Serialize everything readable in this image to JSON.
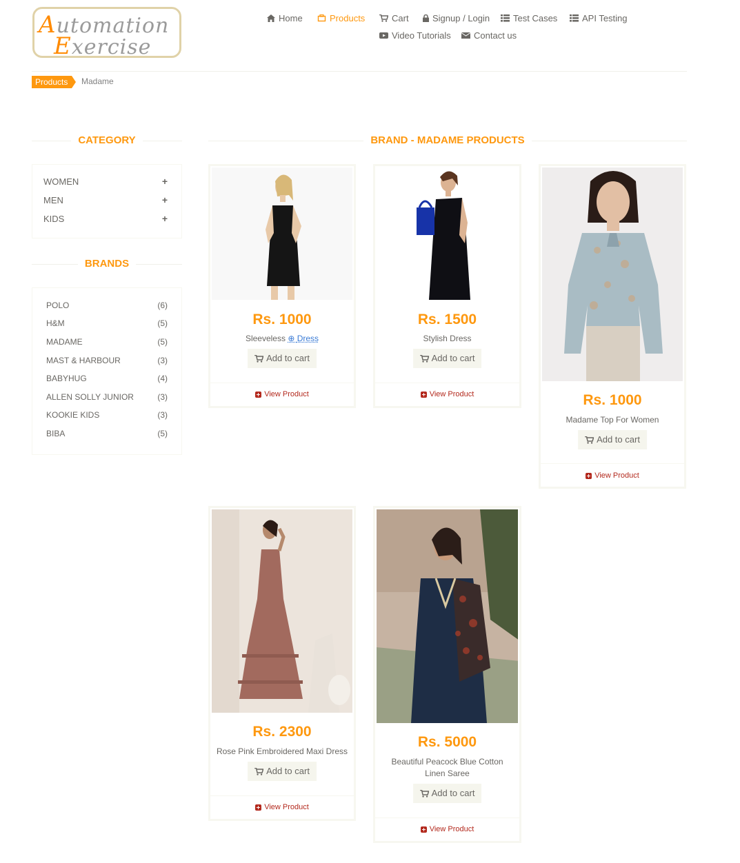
{
  "header": {
    "logo_line1": "Automation",
    "logo_line2": "Exercise",
    "nav": [
      {
        "label": "Home",
        "icon": "home-icon"
      },
      {
        "label": "Products",
        "icon": "tshirt-icon",
        "active": true
      },
      {
        "label": "Cart",
        "icon": "cart-icon"
      },
      {
        "label": "Signup / Login",
        "icon": "lock-icon"
      },
      {
        "label": "Test Cases",
        "icon": "list-icon"
      },
      {
        "label": "API Testing",
        "icon": "list-icon"
      },
      {
        "label": "Video Tutorials",
        "icon": "youtube-icon"
      },
      {
        "label": "Contact us",
        "icon": "envelope-icon"
      }
    ]
  },
  "breadcrumb": {
    "parent": "Products",
    "current": "Madame"
  },
  "sidebar": {
    "category_title": "Category",
    "categories": [
      {
        "label": "Women",
        "toggle": "+"
      },
      {
        "label": "Men",
        "toggle": "+"
      },
      {
        "label": "Kids",
        "toggle": "+"
      }
    ],
    "brands_title": "Brands",
    "brands": [
      {
        "name": "Polo",
        "count": "(6)"
      },
      {
        "name": "H&M",
        "count": "(5)"
      },
      {
        "name": "Madame",
        "count": "(5)"
      },
      {
        "name": "Mast & Harbour",
        "count": "(3)"
      },
      {
        "name": "Babyhug",
        "count": "(4)"
      },
      {
        "name": "Allen Solly Junior",
        "count": "(3)"
      },
      {
        "name": "Kookie Kids",
        "count": "(3)"
      },
      {
        "name": "Biba",
        "count": "(5)"
      }
    ]
  },
  "main": {
    "title": "Brand - Madame Products",
    "add_to_cart_label": "Add to cart",
    "view_product_label": "View Product",
    "products": [
      {
        "price": "Rs. 1000",
        "name_part1": "Sleeveless",
        "name_part2": "Dress",
        "name": "Sleeveless Dress"
      },
      {
        "price": "Rs. 1500",
        "name": "Stylish Dress"
      },
      {
        "price": "Rs. 1000",
        "name": "Madame Top For Women"
      },
      {
        "price": "Rs. 2300",
        "name": "Rose Pink Embroidered Maxi Dress"
      },
      {
        "price": "Rs. 5000",
        "name": "Beautiful Peacock Blue Cotton Linen Saree"
      }
    ]
  },
  "colors": {
    "accent": "#fe980f",
    "view_link": "#b3291d",
    "text": "#696763"
  }
}
